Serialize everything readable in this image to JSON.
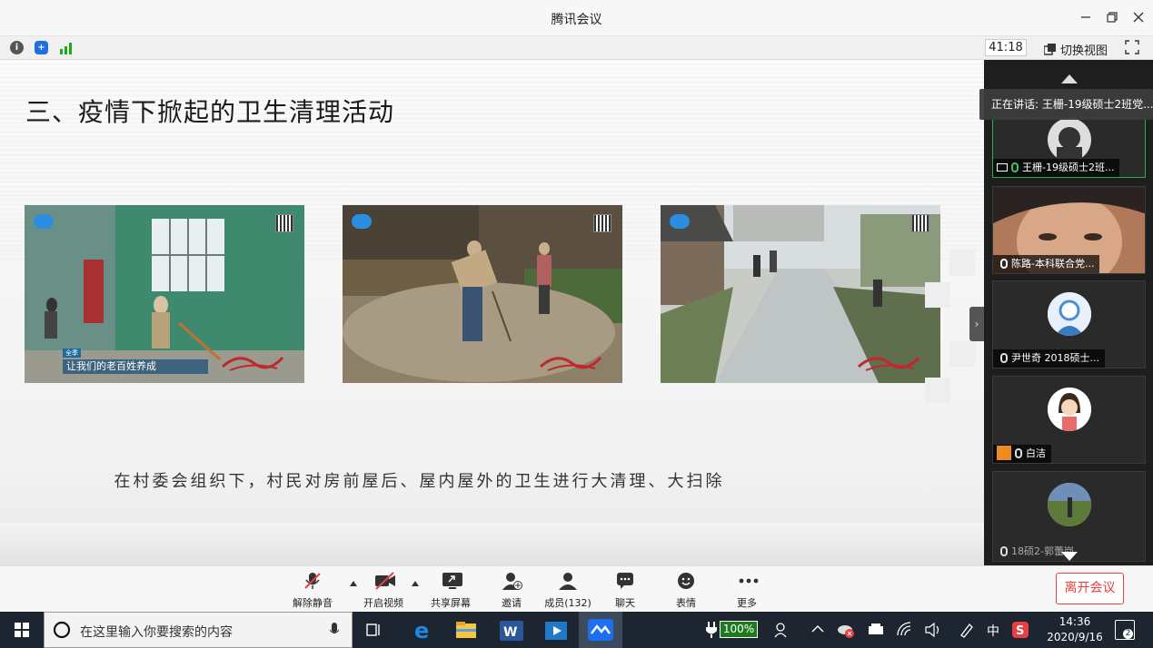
{
  "window": {
    "title": "腾讯会议"
  },
  "infobar": {
    "timer": "41:18",
    "switch_view": "切换视图"
  },
  "slide": {
    "title": "三、疫情下掀起的卫生清理活动",
    "photo1_tag": "全季",
    "photo1_caption": "让我们的老百姓养成",
    "subtitle": "在村委会组织下，村民对房前屋后、屋内屋外的卫生进行大清理、大扫除"
  },
  "panel": {
    "speaking": "正在讲话: 王栅-19级硕士2班党...",
    "participants": [
      {
        "name": "王栅-19级硕士2班...",
        "active": true
      },
      {
        "name": "陈路-本科联合党..."
      },
      {
        "name": "尹世奇 2018硕士..."
      },
      {
        "name": "白洁"
      },
      {
        "name": "18硕2-郭蕾岗"
      }
    ]
  },
  "toolbar": {
    "unmute": "解除静音",
    "start_video": "开启视频",
    "share": "共享屏幕",
    "invite": "邀请",
    "members": "成员(132)",
    "chat": "聊天",
    "reactions": "表情",
    "more": "更多",
    "leave": "离开会议"
  },
  "taskbar": {
    "search_placeholder": "在这里输入你要搜索的内容",
    "battery": "100%",
    "ime": "中",
    "time": "14:36",
    "date": "2020/9/16",
    "notifications": "2"
  },
  "colors": {
    "accent_red": "#e84040",
    "active_green": "#22b14c",
    "signal_green": "#1aad19",
    "shield_blue": "#1e6fe0"
  }
}
